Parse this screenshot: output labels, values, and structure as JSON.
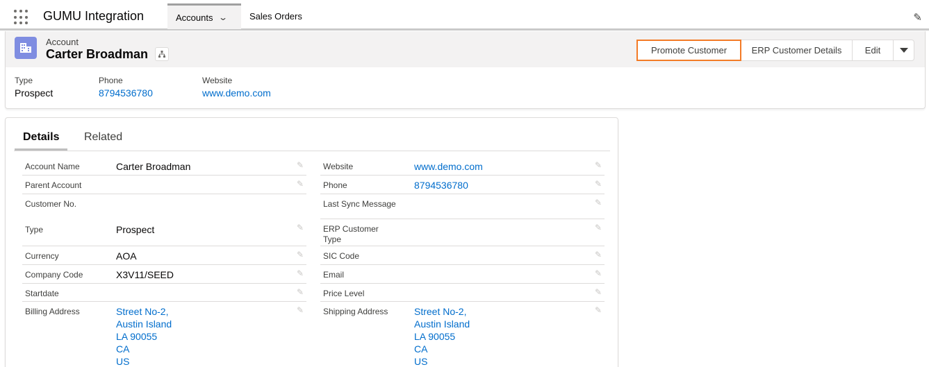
{
  "app": {
    "title": "GUMU Integration",
    "tabs": [
      {
        "label": "Accounts",
        "active": true
      },
      {
        "label": "Sales Orders",
        "active": false
      }
    ]
  },
  "record": {
    "object_type": "Account",
    "name": "Carter Broadman",
    "actions": [
      "Promote Customer",
      "ERP Customer Details",
      "Edit"
    ],
    "highlights": [
      {
        "label": "Type",
        "value": "Prospect",
        "link": false
      },
      {
        "label": "Phone",
        "value": "8794536780",
        "link": true
      },
      {
        "label": "Website",
        "value": "www.demo.com",
        "link": true
      }
    ]
  },
  "details": {
    "tabs": [
      "Details",
      "Related"
    ],
    "left": [
      {
        "label": "Account Name",
        "value": "Carter Broadman"
      },
      {
        "label": "Parent Account",
        "value": ""
      },
      {
        "label": "Customer No.",
        "value": ""
      },
      {
        "label": "Type",
        "value": "Prospect"
      },
      {
        "label": "Currency",
        "value": "AOA"
      },
      {
        "label": "Company Code",
        "value": "X3V11/SEED"
      },
      {
        "label": "Startdate",
        "value": ""
      },
      {
        "label": "Billing Address",
        "value_lines": [
          "Street No-2,",
          "Austin Island",
          "LA 90055",
          "CA",
          "US"
        ]
      }
    ],
    "right": [
      {
        "label": "Website",
        "value": "www.demo.com"
      },
      {
        "label": "Phone",
        "value": "8794536780"
      },
      {
        "label": "Last Sync Message",
        "value": ""
      },
      {
        "label": "ERP Customer Type",
        "value": ""
      },
      {
        "label": "SIC Code",
        "value": ""
      },
      {
        "label": "Email",
        "value": ""
      },
      {
        "label": "Price Level",
        "value": ""
      },
      {
        "label": "Shipping Address",
        "value_lines": [
          "Street No-2,",
          "Austin Island",
          "LA 90055",
          "CA",
          "US"
        ]
      }
    ]
  },
  "colors": {
    "link": "#006dcc",
    "accent_highlight": "#f37b26",
    "account_icon": "#7f8de1"
  },
  "icons": {
    "app_launcher": "waffle-icon",
    "edit_nav": "pencil-icon",
    "account": "account-building-icon",
    "hierarchy": "hierarchy-icon",
    "more_actions": "chevron-down-icon"
  }
}
